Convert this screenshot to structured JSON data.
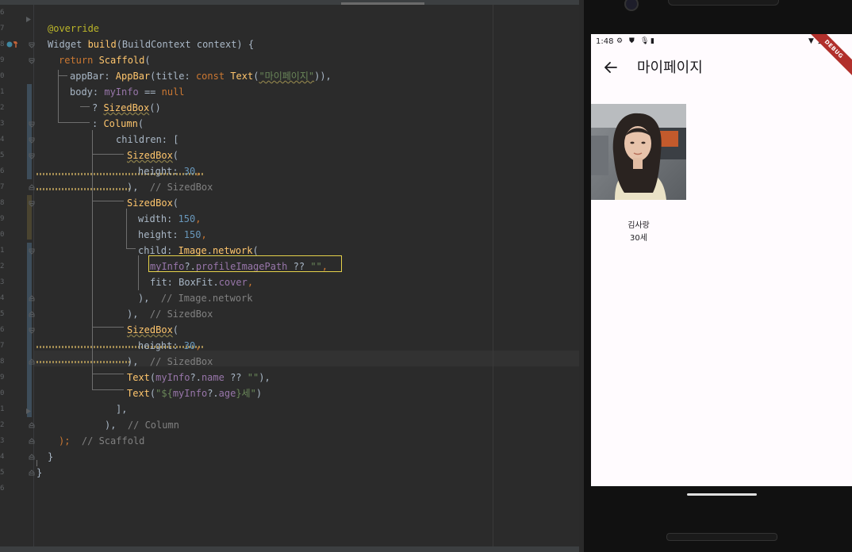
{
  "editor": {
    "line_numbers": [
      "6",
      "7",
      "8",
      "9",
      "0",
      "1",
      "2",
      "3",
      "4",
      "5",
      "6",
      "7",
      "8",
      "9",
      "0",
      "1",
      "2",
      "3",
      "4",
      "5",
      "6",
      "7",
      "8",
      "9",
      "0",
      "1",
      "2",
      "3",
      "4",
      "5",
      "6"
    ],
    "code": {
      "l1": "@override",
      "l2a": "Widget ",
      "l2b": "build",
      "l2c": "(BuildContext context) {",
      "l3a": "return ",
      "l3b": "Scaffold",
      "l3c": "(",
      "l4a": "appBar: ",
      "l4b": "AppBar",
      "l4c": "(title: ",
      "l4d": "const ",
      "l4e": "Text",
      "l4f": "(",
      "l4g": "\"마이페이지\"",
      "l4h": ")),",
      "l5a": "body: ",
      "l5b": "myInfo",
      "l5c": " == ",
      "l5d": "null",
      "l6a": "? ",
      "l6b": "SizedBox",
      "l6c": "()",
      "l7a": ": ",
      "l7b": "Column",
      "l7c": "(",
      "l8": "children: [",
      "l9a": "SizedBox",
      "l9b": "(",
      "l10a": "height: ",
      "l10b": "30",
      "l10c": ",",
      "l11a": "),",
      "l11b": "  // SizedBox",
      "l12a": "SizedBox",
      "l12b": "(",
      "l13a": "width: ",
      "l13b": "150",
      "l13c": ",",
      "l14a": "height: ",
      "l14b": "150",
      "l14c": ",",
      "l15a": "child: ",
      "l15b": "Image",
      "l15c": ".",
      "l15d": "network",
      "l15e": "(",
      "l16a": "myInfo",
      "l16b": "?.",
      "l16c": "profileImagePath",
      "l16d": " ?? ",
      "l16e": "\"\"",
      "l16f": ",",
      "l17a": "fit: BoxFit.",
      "l17b": "cover",
      "l17c": ",",
      "l18a": "),",
      "l18b": "  // Image.network",
      "l19a": "),",
      "l19b": "  // SizedBox",
      "l20a": "SizedBox",
      "l20b": "(",
      "l21a": "height: ",
      "l21b": "30",
      "l21c": ",",
      "l22a": "),",
      "l22b": "  // SizedBox",
      "l23a": "Text",
      "l23b": "(",
      "l23c": "myInfo",
      "l23d": "?.",
      "l23e": "name",
      "l23f": " ?? ",
      "l23g": "\"\"",
      "l23h": "),",
      "l24a": "Text",
      "l24b": "(",
      "l24c": "\"${",
      "l24d": "myInfo",
      "l24e": "?.",
      "l24f": "age",
      "l24g": "}세\"",
      "l24h": ")",
      "l25": "],",
      "l26a": "),",
      "l26b": "  // Column",
      "l27a": ");",
      "l27b": "  // Scaffold",
      "l28": "}",
      "l29": "}"
    }
  },
  "phone": {
    "status": {
      "time": "1:48"
    },
    "appbar": {
      "title": "마이페이지"
    },
    "debug_banner": "DEBUG",
    "profile": {
      "name": "김사랑",
      "age": "30세"
    }
  },
  "colors": {
    "editor_bg": "#2b2b2b",
    "highlight_box": "#e5d14a",
    "debug_banner": "#b1302c",
    "screen_bg": "#fffbfe"
  }
}
